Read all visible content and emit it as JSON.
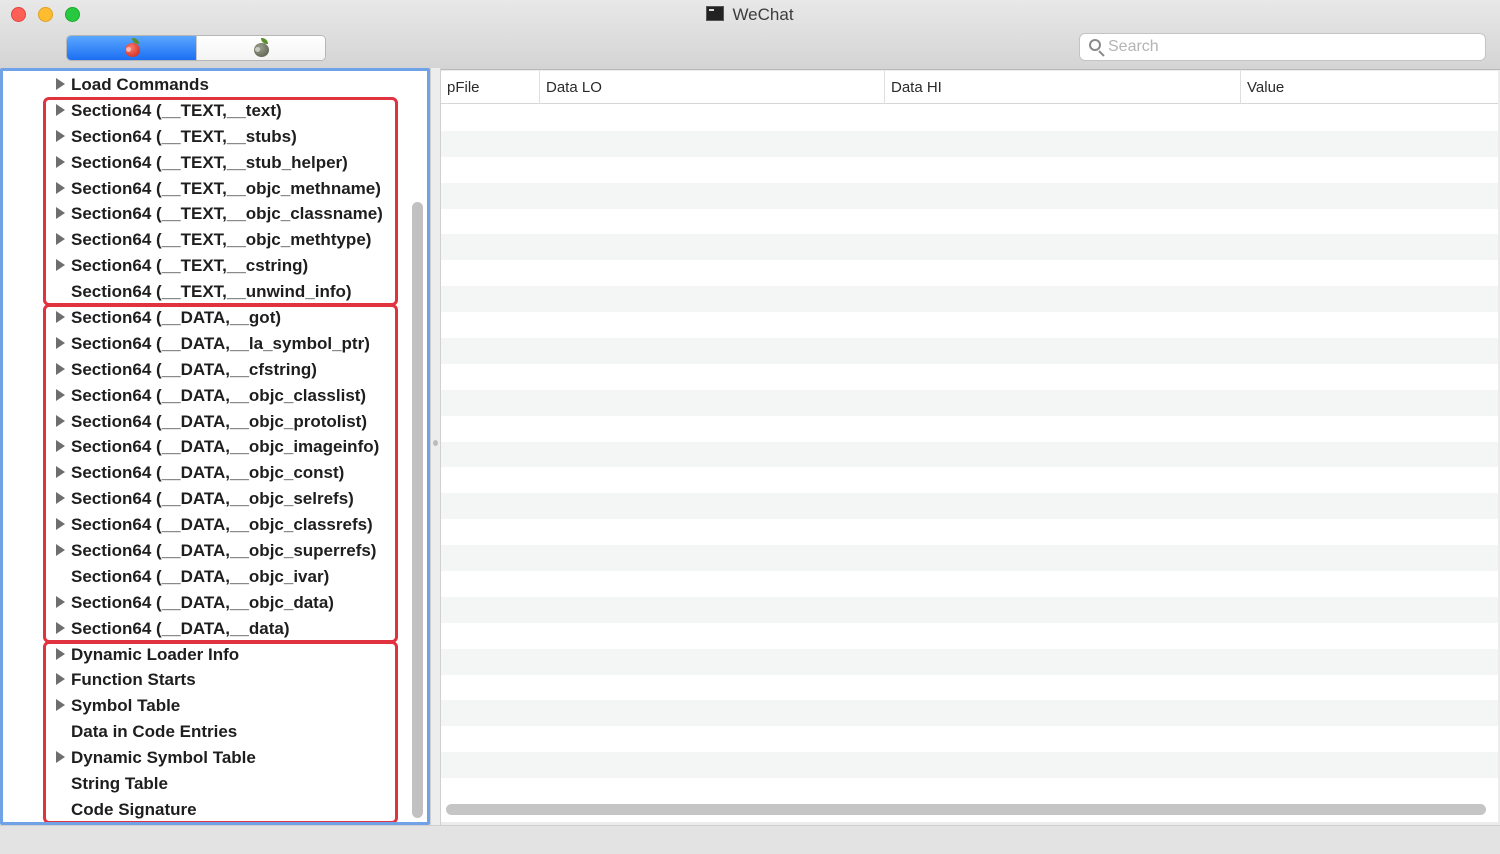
{
  "window": {
    "title": "WeChat"
  },
  "toolbar": {
    "segments": [
      {
        "icon": "red-bug-icon",
        "selected": true
      },
      {
        "icon": "grey-bug-icon",
        "selected": false
      }
    ],
    "search": {
      "placeholder": "Search",
      "value": ""
    }
  },
  "outline": {
    "rows": [
      {
        "label": "Load Commands",
        "expandable": true
      },
      {
        "label": "Section64 (__TEXT,__text)",
        "expandable": true
      },
      {
        "label": "Section64 (__TEXT,__stubs)",
        "expandable": true
      },
      {
        "label": "Section64 (__TEXT,__stub_helper)",
        "expandable": true
      },
      {
        "label": "Section64 (__TEXT,__objc_methname)",
        "expandable": true
      },
      {
        "label": "Section64 (__TEXT,__objc_classname)",
        "expandable": true
      },
      {
        "label": "Section64 (__TEXT,__objc_methtype)",
        "expandable": true
      },
      {
        "label": "Section64 (__TEXT,__cstring)",
        "expandable": true
      },
      {
        "label": "Section64 (__TEXT,__unwind_info)",
        "expandable": false
      },
      {
        "label": "Section64 (__DATA,__got)",
        "expandable": true
      },
      {
        "label": "Section64 (__DATA,__la_symbol_ptr)",
        "expandable": true
      },
      {
        "label": "Section64 (__DATA,__cfstring)",
        "expandable": true
      },
      {
        "label": "Section64 (__DATA,__objc_classlist)",
        "expandable": true
      },
      {
        "label": "Section64 (__DATA,__objc_protolist)",
        "expandable": true
      },
      {
        "label": "Section64 (__DATA,__objc_imageinfo)",
        "expandable": true
      },
      {
        "label": "Section64 (__DATA,__objc_const)",
        "expandable": true
      },
      {
        "label": "Section64 (__DATA,__objc_selrefs)",
        "expandable": true
      },
      {
        "label": "Section64 (__DATA,__objc_classrefs)",
        "expandable": true
      },
      {
        "label": "Section64 (__DATA,__objc_superrefs)",
        "expandable": true
      },
      {
        "label": "Section64 (__DATA,__objc_ivar)",
        "expandable": false
      },
      {
        "label": "Section64 (__DATA,__objc_data)",
        "expandable": true
      },
      {
        "label": "Section64 (__DATA,__data)",
        "expandable": true
      },
      {
        "label": "Dynamic Loader Info",
        "expandable": true
      },
      {
        "label": "Function Starts",
        "expandable": true
      },
      {
        "label": "Symbol Table",
        "expandable": true
      },
      {
        "label": "Data in Code Entries",
        "expandable": false
      },
      {
        "label": "Dynamic Symbol Table",
        "expandable": true
      },
      {
        "label": "String Table",
        "expandable": false
      },
      {
        "label": "Code Signature",
        "expandable": false
      }
    ],
    "highlight_groups": [
      {
        "name": "TEXT sections",
        "first_row": 1,
        "last_row": 8
      },
      {
        "name": "DATA sections",
        "first_row": 9,
        "last_row": 21
      },
      {
        "name": "Linkedit data",
        "first_row": 22,
        "last_row": 28
      }
    ]
  },
  "table": {
    "columns": [
      "pFile",
      "Data LO",
      "Data HI",
      "Value"
    ],
    "rows": []
  },
  "colors": {
    "highlight_box": "#e0323f",
    "focus_ring": "#6fa2e6",
    "selected_segment": "#1c6ff3"
  }
}
